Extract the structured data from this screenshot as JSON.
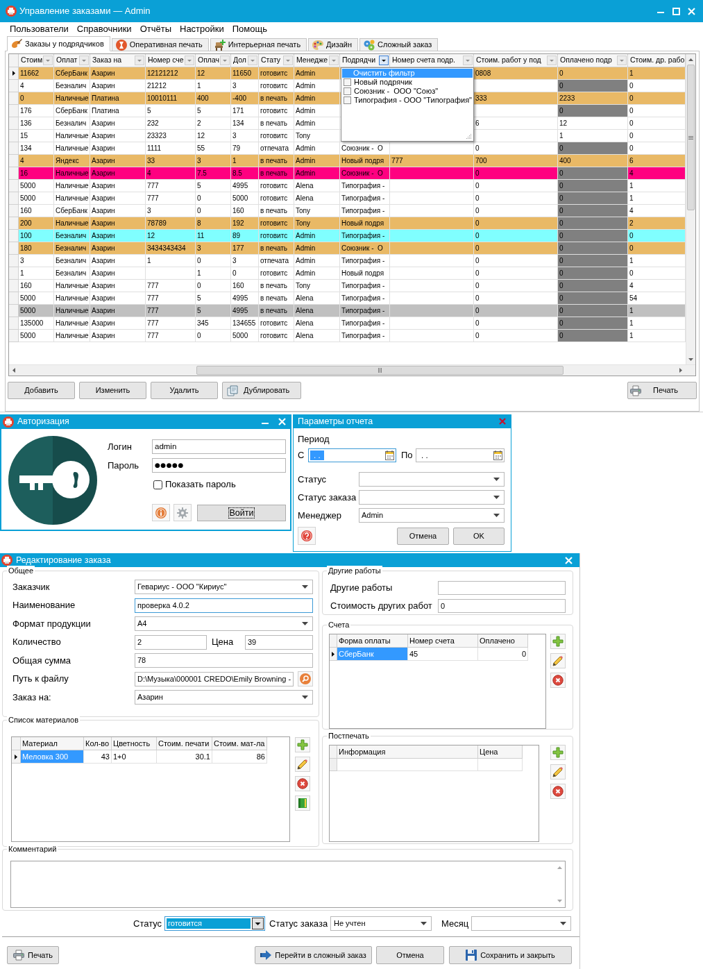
{
  "main_window": {
    "title": "Управление заказами — Admin",
    "menu": [
      "Пользователи",
      "Справочники",
      "Отчёты",
      "Настройки",
      "Помощь"
    ],
    "tabs": [
      {
        "label": "Заказы у подрядчиков",
        "selected": true
      },
      {
        "label": "Оперативная печать",
        "selected": false
      },
      {
        "label": "Интерьерная печать",
        "selected": false
      },
      {
        "label": "Дизайн",
        "selected": false
      },
      {
        "label": "Сложный заказ",
        "selected": false
      }
    ],
    "table": {
      "columns": [
        {
          "label": "Стоим",
          "filter_open": false
        },
        {
          "label": "Оплат",
          "filter_open": false
        },
        {
          "label": "Заказ на",
          "filter_open": false
        },
        {
          "label": "Номер сче",
          "filter_open": false
        },
        {
          "label": "Оплач",
          "filter_open": false
        },
        {
          "label": "Дол",
          "filter_open": false
        },
        {
          "label": "Стату",
          "filter_open": false
        },
        {
          "label": "Менедже",
          "filter_open": false
        },
        {
          "label": "Подрядчи",
          "filter_open": true
        },
        {
          "label": "Номер счета подр.",
          "filter_open": false
        },
        {
          "label": "Стоим. работ у под",
          "filter_open": false
        },
        {
          "label": "Оплачено подр",
          "filter_open": false
        },
        {
          "label": "Стоим. др. рабо"
        }
      ],
      "rows": [
        {
          "selected": true,
          "color": "#e9b966",
          "flagged": false,
          "cells": [
            "11662",
            "СберБанк",
            "Азарин",
            "12121212",
            "12",
            "11650",
            "готовитс",
            "Admin",
            null,
            null,
            "0808",
            "0",
            "1"
          ]
        },
        {
          "selected": false,
          "flagged": true,
          "cells": [
            "4",
            "Безналич",
            "Азарин",
            "21212",
            "1",
            "3",
            "готовитс",
            "Admin",
            null,
            null,
            null,
            "0",
            "0"
          ]
        },
        {
          "selected": false,
          "color": "#e9b966",
          "flagged": false,
          "cells": [
            "0",
            "Наличные",
            "Платина",
            "10010111",
            "400",
            "-400",
            "в печать",
            "Admin",
            null,
            null,
            "333",
            "2233",
            "0"
          ]
        },
        {
          "selected": false,
          "flagged": true,
          "cells": [
            "176",
            "СберБанк",
            "Платина",
            "5",
            "5",
            "171",
            "готовитс",
            "Admin",
            null,
            null,
            null,
            "0",
            "0"
          ]
        },
        {
          "selected": false,
          "flagged": false,
          "cells": [
            "136",
            "Безналич",
            "Азарин",
            "232",
            "2",
            "134",
            "в печать",
            "Admin",
            null,
            null,
            "6",
            "12",
            "0"
          ]
        },
        {
          "selected": false,
          "flagged": false,
          "cells": [
            "15",
            "Наличные",
            "Азарин",
            "23323",
            "12",
            "3",
            "готовитс",
            "Tony",
            null,
            null,
            null,
            "1",
            "0"
          ]
        },
        {
          "selected": false,
          "flagged": true,
          "cells": [
            "134",
            "Наличные",
            "Азарин",
            "1111",
            "55",
            "79",
            "отпечата",
            "Admin",
            "Союзник -  О",
            null,
            "0",
            "0",
            "0"
          ]
        },
        {
          "selected": false,
          "color": "#e9b966",
          "flagged": false,
          "cells": [
            "4",
            "Яндекс",
            "Азарин",
            "33",
            "3",
            "1",
            "в печать",
            "Admin",
            "Новый подря",
            "777",
            "700",
            "400",
            "6"
          ]
        },
        {
          "selected": false,
          "color": "#ff0080",
          "flagged": true,
          "cells": [
            "16",
            "Наличные",
            "Азарин",
            "4",
            "7.5",
            "8.5",
            "в печать",
            "Admin",
            "Союзник -  О",
            null,
            "0",
            "0",
            "4"
          ]
        },
        {
          "selected": false,
          "flagged": true,
          "cells": [
            "5000",
            "Наличные",
            "Азарин",
            "777",
            "5",
            "4995",
            "готовитс",
            "Alena",
            "Типография -",
            null,
            "0",
            "0",
            "1"
          ]
        },
        {
          "selected": false,
          "flagged": true,
          "cells": [
            "5000",
            "Наличные",
            "Азарин",
            "777",
            "0",
            "5000",
            "готовитс",
            "Alena",
            "Типография -",
            null,
            "0",
            "0",
            "1"
          ]
        },
        {
          "selected": false,
          "flagged": true,
          "cells": [
            "160",
            "СберБанк",
            "Азарин",
            "3",
            "0",
            "160",
            "в печать",
            "Tony",
            "Типография -",
            null,
            "0",
            "0",
            "4"
          ]
        },
        {
          "selected": false,
          "color": "#e9b966",
          "flagged": true,
          "cells": [
            "200",
            "Наличные",
            "Азарин",
            "78789",
            "8",
            "192",
            "готовитс",
            "Tony",
            "Новый подря",
            null,
            "0",
            "0",
            "2"
          ]
        },
        {
          "selected": false,
          "color": "#80ffff",
          "flagged": true,
          "cells": [
            "100",
            "Безналич",
            "Азарин",
            "12",
            "11",
            "89",
            "готовитс",
            "Admin",
            "Типография -",
            null,
            "0",
            "0",
            "0"
          ]
        },
        {
          "selected": false,
          "color": "#e9b966",
          "flagged": true,
          "cells": [
            "180",
            "Безналич",
            "Азарин",
            "3434343434",
            "3",
            "177",
            "в печать",
            "Admin",
            "Союзник -  О",
            null,
            "0",
            "0",
            "0"
          ]
        },
        {
          "selected": false,
          "flagged": true,
          "cells": [
            "3",
            "Безналич",
            "Азарин",
            "1",
            "0",
            "3",
            "отпечата",
            "Admin",
            "Типография -",
            null,
            "0",
            "0",
            "1"
          ]
        },
        {
          "selected": false,
          "flagged": true,
          "cells": [
            "1",
            "Безналич",
            "Азарин",
            null,
            "1",
            "0",
            "готовитс",
            "Admin",
            "Новый подря",
            null,
            "0",
            "0",
            "0"
          ]
        },
        {
          "selected": false,
          "flagged": true,
          "cells": [
            "160",
            "Наличные",
            "Азарин",
            "777",
            "0",
            "160",
            "в печать",
            "Tony",
            "Типография -",
            null,
            "0",
            "0",
            "4"
          ]
        },
        {
          "selected": false,
          "flagged": true,
          "cells": [
            "5000",
            "Наличные",
            "Азарин",
            "777",
            "5",
            "4995",
            "в печать",
            "Alena",
            "Типография -",
            null,
            "0",
            "0",
            "54"
          ]
        },
        {
          "selected": false,
          "color": "#c0c0c0",
          "flagged": true,
          "cells": [
            "5000",
            "Наличные",
            "Азарин",
            "777",
            "5",
            "4995",
            "в печать",
            "Alena",
            "Типография -",
            null,
            "0",
            "0",
            "1"
          ]
        },
        {
          "selected": false,
          "flagged": true,
          "cells": [
            "135000",
            "Наличные",
            "Азарин",
            "777",
            "345",
            "134655",
            "готовитс",
            "Alena",
            "Типография -",
            null,
            "0",
            "0",
            "1"
          ]
        },
        {
          "selected": false,
          "flagged": true,
          "cells": [
            "5000",
            "Наличные",
            "Азарин",
            "777",
            "0",
            "5000",
            "готовитс",
            "Alena",
            "Типография -",
            null,
            "0",
            "0",
            "1"
          ]
        }
      ],
      "filter_menu": {
        "items": [
          {
            "kind": "action",
            "label": "Очистить фильтр",
            "selected": true
          },
          {
            "kind": "checkbox",
            "label": "Новый подрячик",
            "checked": false,
            "selected": false
          },
          {
            "kind": "checkbox",
            "label": "Союзник -  ООО \"Союз\"",
            "checked": false,
            "selected": false
          },
          {
            "kind": "checkbox",
            "label": "Типография - ООО \"Типография\"",
            "checked": false,
            "selected": false
          }
        ]
      }
    },
    "buttons": [
      "Добавить",
      "Изменить",
      "Удалить",
      "Дублировать"
    ],
    "print_button": "Печать"
  },
  "auth_window": {
    "title": "Авторизация",
    "fields": [
      {
        "label": "Логин",
        "value": "admin"
      },
      {
        "label": "Пароль",
        "value": "●●●●●"
      }
    ],
    "show_password": {
      "label": "Показать пароль",
      "checked": false
    },
    "login_button": {
      "label": "Войти",
      "focused": true
    }
  },
  "report_window": {
    "title": "Параметры отчета",
    "period_label": "Период",
    "from": {
      "label": "С",
      "value": ". .",
      "focused": true
    },
    "to": {
      "label": "По",
      "value": ". ."
    },
    "combos": [
      {
        "label": "Статус"
      },
      {
        "label": "Статус заказа"
      },
      {
        "label": "Менеджер",
        "value": "Admin"
      }
    ],
    "buttons": [
      "Отмена",
      "OK"
    ]
  },
  "edit_window": {
    "title": "Редактирование заказа",
    "general": {
      "title": "Общее",
      "fields": [
        {
          "kind": "combo",
          "label": "Заказчик",
          "value": "Гевариус - ООО \"Кириус\""
        },
        {
          "kind": "text",
          "label": "Наименование",
          "value": "проверка 4.0.2",
          "focused": true
        },
        {
          "kind": "combo",
          "label": "Формат продукции",
          "value": "A4"
        },
        {
          "kind": "pair",
          "label": "Количество",
          "value": "2",
          "label2": "Цена",
          "value2": "39"
        },
        {
          "kind": "text",
          "label": "Общая сумма",
          "value": "78"
        },
        {
          "kind": "file",
          "label": "Путь к файлу",
          "value": "D:\\Музыка\\000001 CREDO\\Emily Browning -"
        },
        {
          "kind": "combo",
          "label": "Заказ на:",
          "value": "Азарин"
        }
      ]
    },
    "other_works": {
      "title": "Другие работы",
      "fields": [
        {
          "label": "Другие работы"
        },
        {
          "label": "Стоимость других работ",
          "value": "0"
        }
      ]
    },
    "accounts": {
      "title": "Счета",
      "columns": [
        "Форма оплаты",
        "Номер счета",
        "Оплачено"
      ],
      "rows": [
        {
          "selected": true,
          "cells": [
            "СберБанк",
            "45",
            "0"
          ]
        }
      ]
    },
    "materials": {
      "title": "Список материалов",
      "columns": [
        "Материал",
        "Кол-во",
        "Цветность",
        "Стоим. печати",
        "Стоим. мат-ла"
      ],
      "rows": [
        {
          "selected": true,
          "cells": [
            "Меловка 300",
            "43",
            "1+0",
            "30.1",
            "86"
          ]
        }
      ]
    },
    "postprint": {
      "title": "Постпечать",
      "columns": [
        "Информация",
        "Цена"
      ],
      "new_row": true
    },
    "comment": {
      "title": "Комментарий"
    },
    "status_row": [
      {
        "label": "Статус",
        "value": "готовится",
        "focused": true
      },
      {
        "label": "Статус заказа",
        "value": "Не учтен"
      },
      {
        "label": "Месяц"
      }
    ],
    "buttons": {
      "print": "Печать",
      "complex": "Перейти в сложный заказ",
      "cancel": "Отмена",
      "save": "Сохранить и закрыть"
    }
  }
}
